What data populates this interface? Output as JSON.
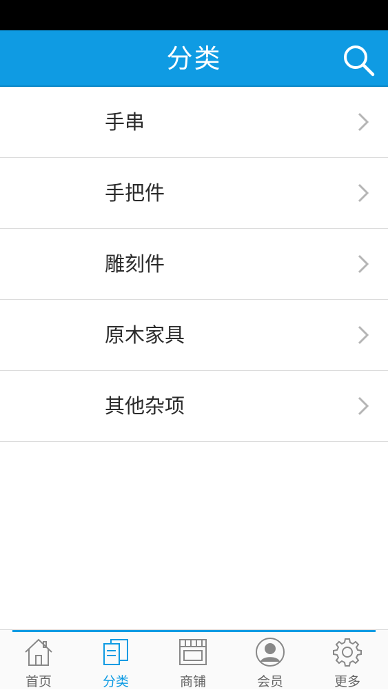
{
  "header": {
    "title": "分类",
    "search_icon": "search-icon",
    "background_color": "#0f9be3"
  },
  "categories": [
    {
      "label": "手串"
    },
    {
      "label": "手把件"
    },
    {
      "label": "雕刻件"
    },
    {
      "label": "原木家具"
    },
    {
      "label": "其他杂项"
    }
  ],
  "tabbar": {
    "active_index": 1,
    "active_color": "#0f9be3",
    "tabs": [
      {
        "label": "首页",
        "icon": "home-icon"
      },
      {
        "label": "分类",
        "icon": "category-icon"
      },
      {
        "label": "商铺",
        "icon": "store-icon"
      },
      {
        "label": "会员",
        "icon": "user-icon"
      },
      {
        "label": "更多",
        "icon": "gear-icon"
      }
    ]
  }
}
